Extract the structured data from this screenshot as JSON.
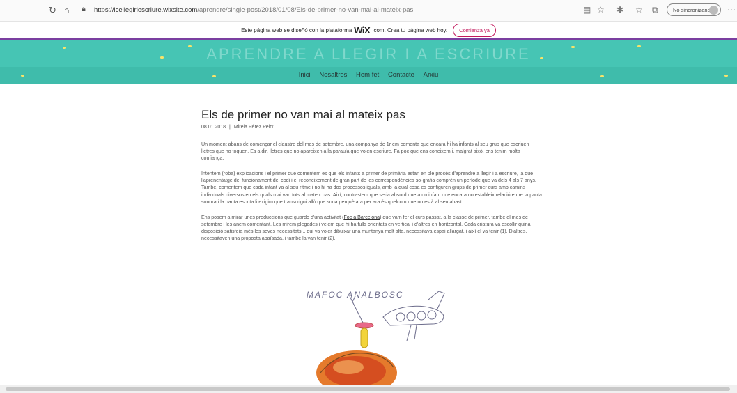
{
  "browser": {
    "url_host": "https://icellegiriescriure.wixsite.com",
    "url_path": "/aprendre/single-post/2018/01/08/Els-de-primer-no-van-mai-al-mateix-pas",
    "profile_label": "No sincronizando"
  },
  "wix_banner": {
    "text_before": "Este página web se diseñó con la plataforma",
    "brand": "WiX",
    "text_after": ".com. Crea tu página web hoy.",
    "cta": "Comienza ya"
  },
  "site": {
    "title": "APRENDRE A LLEGIR I A ESCRIURE",
    "nav": [
      "Inici",
      "Nosaltres",
      "Hem fet",
      "Contacte",
      "Arxiu"
    ],
    "colors": {
      "header": "#46c5b4",
      "nav": "#3fbcab",
      "banner_border": "#7b3fa0"
    }
  },
  "post": {
    "title": "Els de primer no van mai al mateix pas",
    "date": "08.01.2018",
    "separator": "|",
    "author": "Mireia Pérez Peitx",
    "p1": "Un moment abans de començar el claustre del mes de setembre, una companya de 1r em comenta que encara hi ha infants al seu grup que escriuen lletres que no toquen. Es a dir, lletres que no apareixen a la paraula que volen escriure. Fa poc que ens coneixem i, malgrat això, ens tenim molta confiança.",
    "p2": "Intentem (roba) explicacions i el primer que comentem es que els infants a primer de primària estan en ple procés d'aprendre a llegir i a escriure, ja que l'aprenentatge del funcionament del codi i el reconeixement de gran part de les correspondències so-grafia comprèn un període que va dels 4 als 7 anys. També, comentem que cada infant va al seu ritme i no hi ha dos processos iguals, amb la qual cosa es configuren grups de primer curs amb camins individuals diversos en els quals mai van tots al mateix pas. Així, contrastem que seria absurd que a un infant que encara no estableix relació entre la pauta sonora i la pauta escrita li exigim que transcrigui allò que sona perquè ara per ara és quelcom que no està al seu abast.",
    "p3_before": "Ens posem a mirar unes produccions que guardo d'una activitat (",
    "p3_link": "Foc a Barcelona",
    "p3_after": ") que vam fer el curs passat, a la classe de primer, també el mes de setembre i les anem comentant. Les  mirem plegades i veiem que hi ha fulls orientats en vertical i d'altres en horitzontal. Cada criatura va escollir quina disposició satisfeia més les seves necessitats... qui va voler dibuixar una muntanya molt alta, necessitava espai allargat, i així el va tenir (1). D'altres, necessitaven una proposta apaïsada, i també la van tenir (2).",
    "drawing_text": "MAFOC ANALBOSC"
  }
}
